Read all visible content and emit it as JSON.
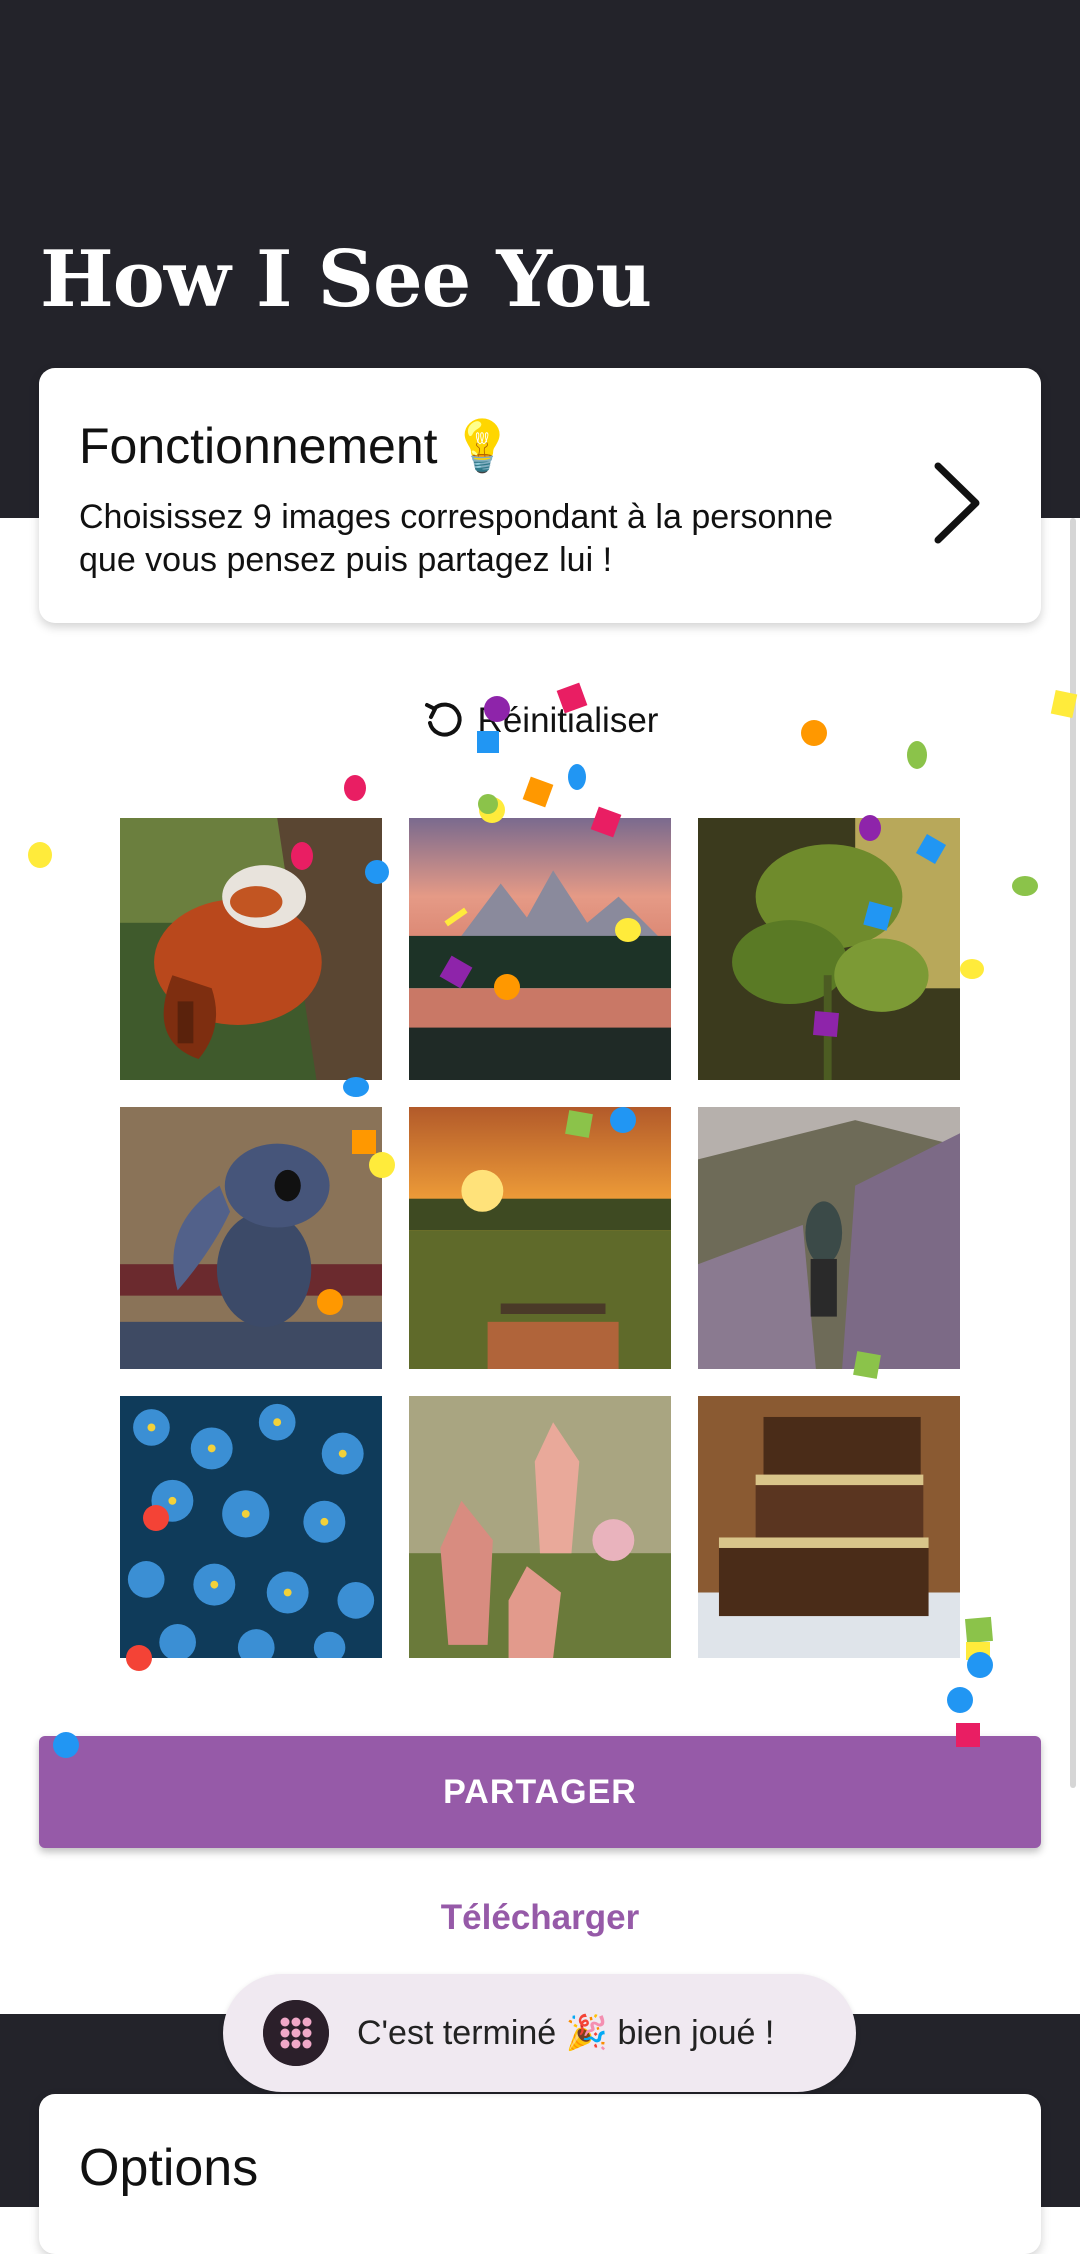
{
  "app": {
    "title": "How I See You"
  },
  "info_card": {
    "title": "Fonctionnement 💡",
    "text": "Choisissez 9 images correspondant à la personne que vous pensez puis partagez lui !"
  },
  "reset": {
    "label": "Réinitialiser"
  },
  "images": [
    {
      "name": "red-panda-image"
    },
    {
      "name": "mountain-lake-sunset-image"
    },
    {
      "name": "monstera-plant-image"
    },
    {
      "name": "stitch-cartoon-image"
    },
    {
      "name": "sunset-field-image"
    },
    {
      "name": "hiker-trail-image"
    },
    {
      "name": "blue-flowers-image"
    },
    {
      "name": "pink-crystals-image"
    },
    {
      "name": "brownies-image"
    }
  ],
  "actions": {
    "share_label": "PARTAGER",
    "download_label": "Télécharger"
  },
  "toast": {
    "text": "C'est terminé 🎉 bien joué !"
  },
  "options": {
    "title": "Options"
  },
  "colors": {
    "accent": "#965aa8",
    "dark_band": "#23232a"
  }
}
